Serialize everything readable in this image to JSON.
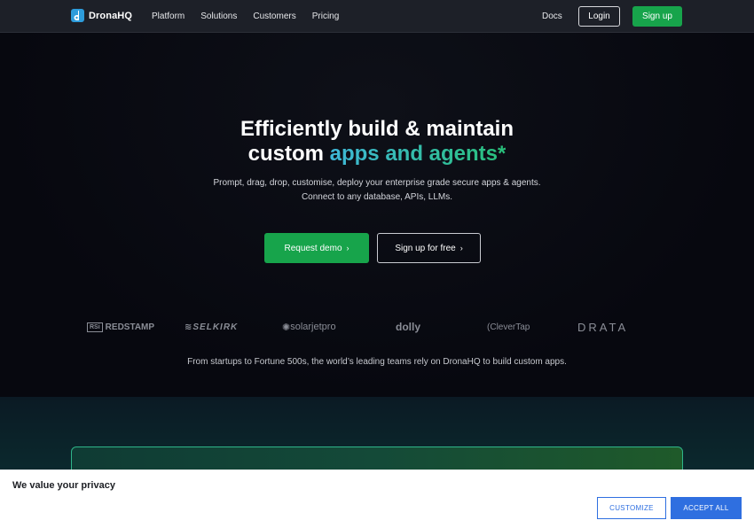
{
  "nav": {
    "brand": "DronaHQ",
    "links": [
      "Platform",
      "Solutions",
      "Customers",
      "Pricing"
    ],
    "docs": "Docs",
    "login": "Login",
    "signup": "Sign up"
  },
  "hero": {
    "title_line1": "Efficiently build & maintain",
    "title_line2_prefix": "custom ",
    "title_line2_accent": "apps and agents*",
    "subtitle_line1": "Prompt, drag, drop, customise, deploy your enterprise grade secure apps & agents.",
    "subtitle_line2": "Connect to any database, APIs, LLMs.",
    "request_demo": "Request demo",
    "signup_free": "Sign up for free",
    "logos": [
      "REDSTAMP",
      "SELKIRK",
      "solarjetpro",
      "dolly",
      "CleverTap",
      "DRATA"
    ],
    "logo_box_text": "RSi",
    "trust_text": "From startups to Fortune 500s, the world’s leading teams rely on DronaHQ to build custom apps."
  },
  "cookie": {
    "title": "We value your privacy",
    "customize": "CUSTOMIZE",
    "accept_all": "ACCEPT ALL"
  },
  "colors": {
    "accent_green": "#17a44b",
    "accent_blue": "#2f6fe0",
    "nav_bg": "#1d2028"
  }
}
